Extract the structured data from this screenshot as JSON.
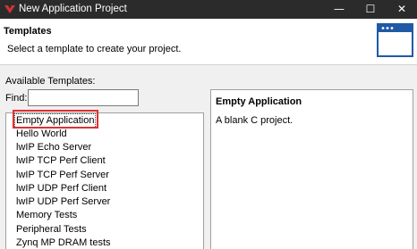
{
  "window": {
    "title": "New Application Project",
    "minimize": "—",
    "maximize": "☐",
    "close": "✕"
  },
  "header": {
    "title": "Templates",
    "description": "Select a template to create your project."
  },
  "available_label": "Available Templates:",
  "find": {
    "label": "Find:",
    "value": ""
  },
  "templates": [
    "Empty Application",
    "Hello World",
    "lwIP Echo Server",
    "lwIP TCP Perf Client",
    "lwIP TCP Perf Server",
    "lwIP UDP Perf Client",
    "lwIP UDP Perf Server",
    "Memory Tests",
    "Peripheral Tests",
    "Zynq MP DRAM tests"
  ],
  "selected_template": "Empty Application",
  "details": {
    "title": "Empty Application",
    "text": "A blank C project."
  },
  "colors": {
    "titlebar": "#2b2b2b",
    "highlight": "#e03030",
    "banner_blue": "#1f5aa6"
  }
}
